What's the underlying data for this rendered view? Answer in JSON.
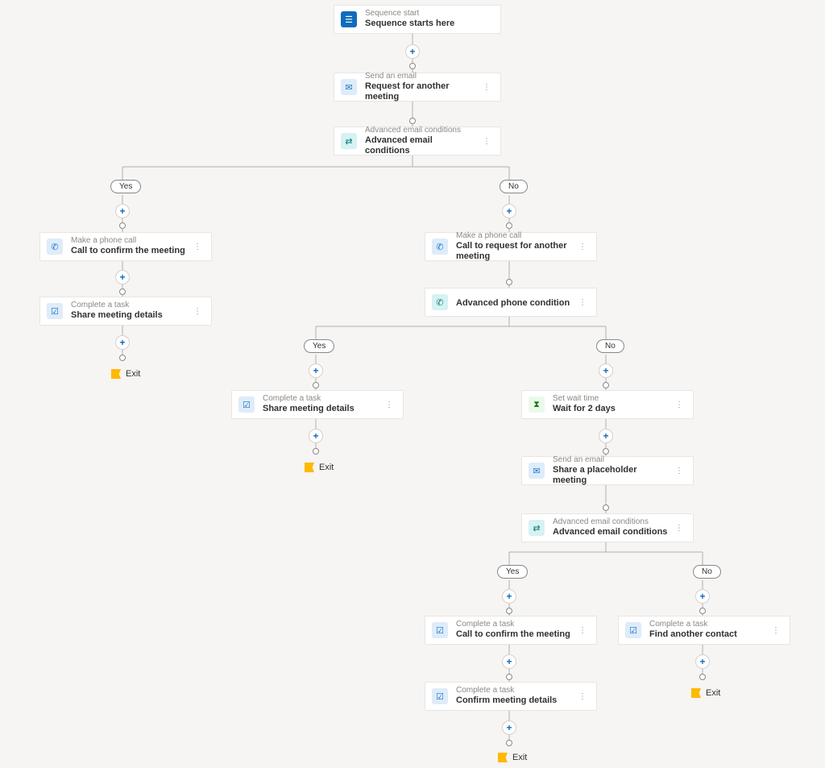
{
  "labels": {
    "yes": "Yes",
    "no": "No",
    "exit": "Exit"
  },
  "nodes": {
    "start": {
      "sub": "Sequence start",
      "title": "Sequence starts here"
    },
    "email1": {
      "sub": "Send an email",
      "title": "Request for another meeting"
    },
    "cond_email1": {
      "sub": "Advanced email conditions",
      "title": "Advanced email conditions"
    },
    "call_yes": {
      "sub": "Make a phone call",
      "title": "Call to confirm the meeting"
    },
    "task_share1": {
      "sub": "Complete a task",
      "title": "Share meeting details"
    },
    "call_no": {
      "sub": "Make a phone call",
      "title": "Call to request for another meeting"
    },
    "cond_phone": {
      "sub": "",
      "title": "Advanced phone condition"
    },
    "task_share2": {
      "sub": "Complete a task",
      "title": "Share meeting details"
    },
    "wait": {
      "sub": "Set wait time",
      "title": "Wait for 2 days"
    },
    "email2": {
      "sub": "Send an email",
      "title": "Share a placeholder meeting"
    },
    "cond_email2": {
      "sub": "Advanced email conditions",
      "title": "Advanced email conditions"
    },
    "task_confirm_call": {
      "sub": "Complete a task",
      "title": "Call to confirm the meeting"
    },
    "task_confirm_mtg": {
      "sub": "Complete a task",
      "title": "Confirm meeting details"
    },
    "task_find": {
      "sub": "Complete a task",
      "title": "Find another contact"
    }
  }
}
